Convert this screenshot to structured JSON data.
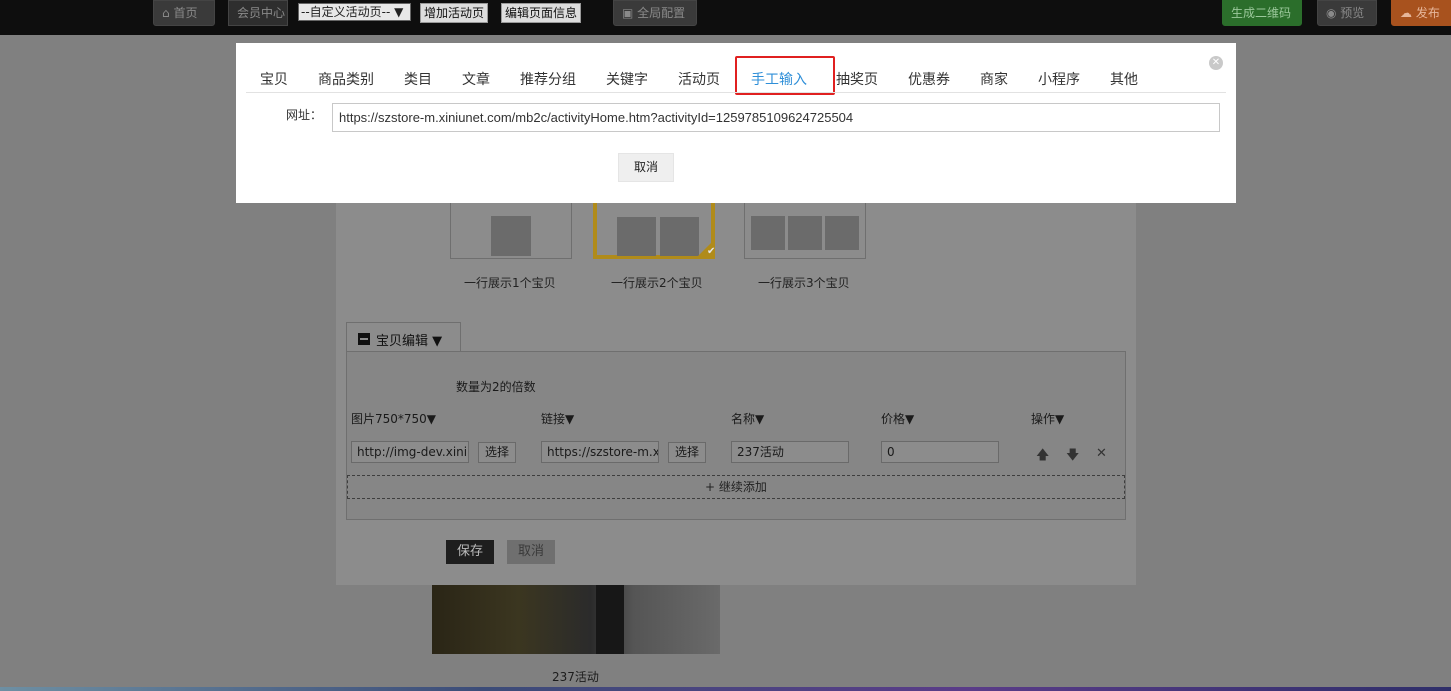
{
  "topbar": {
    "home": "首页",
    "member": "会员中心",
    "activity_select": "--自定义活动页--",
    "add_activity": "增加活动页",
    "edit_page_info": "编辑页面信息",
    "global_config": "全局配置",
    "qr_code": "生成二维码",
    "preview": "预览",
    "publish": "发布"
  },
  "layouts": [
    {
      "label": "一行展示1个宝贝"
    },
    {
      "label": "一行展示2个宝贝"
    },
    {
      "label": "一行展示3个宝贝"
    }
  ],
  "editor": {
    "tab_label": "宝贝编辑 ▼",
    "hint": "数量为2的倍数",
    "columns": [
      "图片750*750▼",
      "链接▼",
      "名称▼",
      "价格▼",
      "操作▼"
    ],
    "row": {
      "image_url": "http://img-dev.xiniun",
      "link_url": "https://szstore-m.xin",
      "name": "237活动",
      "price": "0",
      "select": "选择"
    },
    "add_more": "继续添加",
    "save": "保存",
    "cancel": "取消"
  },
  "preview_caption": "237活动",
  "modal": {
    "tabs": [
      "宝贝",
      "商品类别",
      "类目",
      "文章",
      "推荐分组",
      "关键字",
      "活动页",
      "手工输入",
      "抽奖页",
      "优惠券",
      "商家",
      "小程序",
      "其他"
    ],
    "active_tab": "手工输入",
    "url_label": "网址：",
    "url_value": "https://szstore-m.xiniunet.com/mb2c/activityHome.htm?activityId=1259785109624725504",
    "cancel": "取消"
  },
  "colors": {
    "active_tab": "#2f8fd8",
    "highlight_outline": "#e02020",
    "selected_layout": "#b08b1a"
  }
}
